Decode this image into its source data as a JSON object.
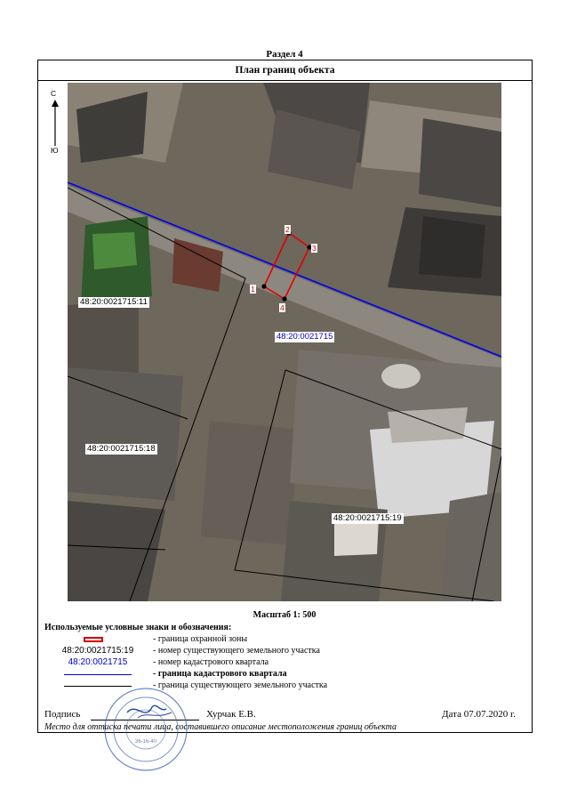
{
  "section": "Раздел 4",
  "header": "План границ объекта",
  "compass": {
    "north": "С",
    "south": "Ю"
  },
  "map": {
    "labels": {
      "parcel_11": "48:20:0021715:11",
      "parcel_18": "48:20:0021715:18",
      "parcel_19": "48:20:0021715:19",
      "quarter": "48:20:0021715"
    },
    "points": [
      "1",
      "2",
      "3",
      "4"
    ]
  },
  "scale": "Масштаб 1: 500",
  "legend": {
    "title": "Используемые условные знаки и обозначения:",
    "items": [
      {
        "symbol": "",
        "desc": "- граница  охранной зоны"
      },
      {
        "symbol": "48:20:0021715:19",
        "desc": "- номер существующего земельного участка"
      },
      {
        "symbol": "48:20:0021715",
        "desc": "- номер кадастрового квартала"
      },
      {
        "symbol": "",
        "desc": "- граница кадастрового квартала"
      },
      {
        "symbol": "",
        "desc": "- граница существующего земельного участка"
      }
    ],
    "colors": {
      "zone": "#d00000",
      "quarter": "#0000cc",
      "parcel": "#000000"
    }
  },
  "signature": {
    "label": "Подпись",
    "name": "Хурчак Е.В.",
    "date": "Дата 07.07.2020 г.",
    "note": "Место для оттиска печати лица, составившего описание местоположения границ объекта"
  },
  "stamp": {
    "number": "36-16-40"
  }
}
